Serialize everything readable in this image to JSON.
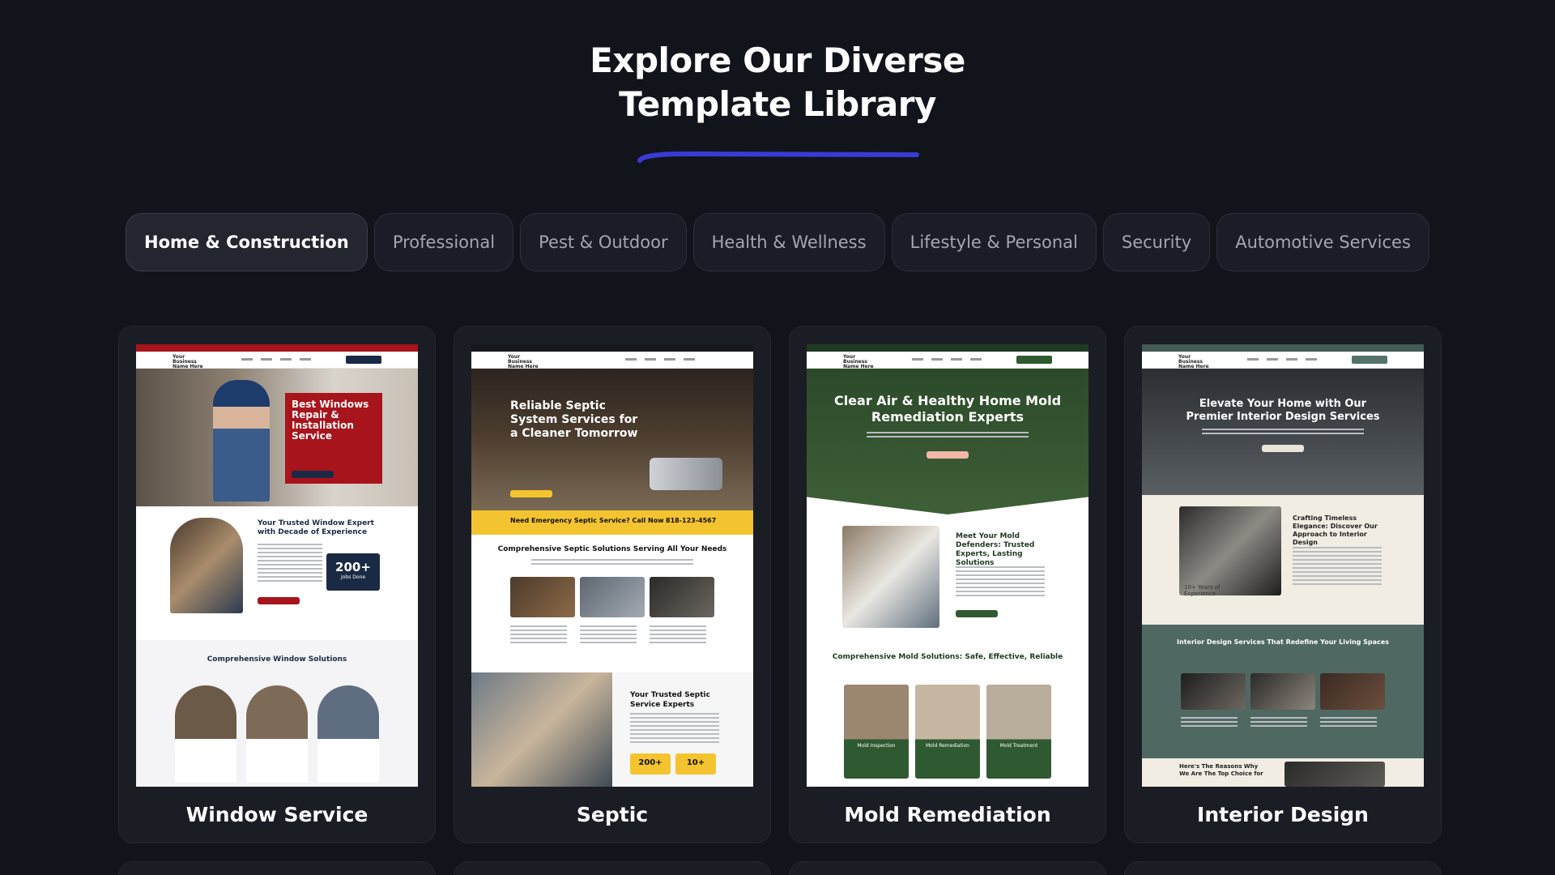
{
  "heading": {
    "line1": "Explore Our Diverse",
    "line2": "Template Library"
  },
  "colors": {
    "accent": "#3a3bd6",
    "background": "#11141b",
    "card": "#1a1d24"
  },
  "tabs": [
    {
      "label": "Home & Construction",
      "active": true
    },
    {
      "label": "Professional",
      "active": false
    },
    {
      "label": "Pest & Outdoor",
      "active": false
    },
    {
      "label": "Health & Wellness",
      "active": false
    },
    {
      "label": "Lifestyle & Personal",
      "active": false
    },
    {
      "label": "Security",
      "active": false
    },
    {
      "label": "Automotive Services",
      "active": false
    }
  ],
  "templates": [
    {
      "title": "Window Service",
      "preview": {
        "logo": "Your Business Name Here",
        "hero": "Best Windows Repair & Installation Service",
        "section1": "Your Trusted Window Expert with Decade of Experience",
        "stat": "200+",
        "stat_label": "Jobs Done",
        "section2": "Comprehensive Window Solutions"
      }
    },
    {
      "title": "Septic",
      "preview": {
        "logo": "Your Business Name Here",
        "hero": "Reliable Septic System Services for a Cleaner Tomorrow",
        "banner": "Need Emergency Septic Service? Call Now",
        "phone": "818-123-4567",
        "section1": "Comprehensive Septic Solutions Serving All Your Needs",
        "section2": "Your Trusted Septic Service Experts",
        "stat1": "200+",
        "stat2": "10+"
      }
    },
    {
      "title": "Mold Remediation",
      "preview": {
        "logo": "Your Business Name Here",
        "hero": "Clear Air & Healthy Home Mold Remediation Experts",
        "section1": "Meet Your Mold Defenders: Trusted Experts, Lasting Solutions",
        "section2": "Comprehensive Mold Solutions: Safe, Effective, Reliable",
        "items": [
          "Mold Inspection",
          "Mold Remediation",
          "Mold Treatment"
        ]
      }
    },
    {
      "title": "Interior Design",
      "preview": {
        "logo": "Your Business Name Here",
        "hero": "Elevate Your Home with Our Premier Interior Design Services",
        "section1": "Crafting Timeless Elegance: Discover Our Approach to Interior Design",
        "badge": "10+ Years of Experience",
        "section2": "Interior Design Services That Redefine Your Living Spaces",
        "section3": "Here's The Reasons Why We Are The Top Choice for"
      }
    }
  ]
}
